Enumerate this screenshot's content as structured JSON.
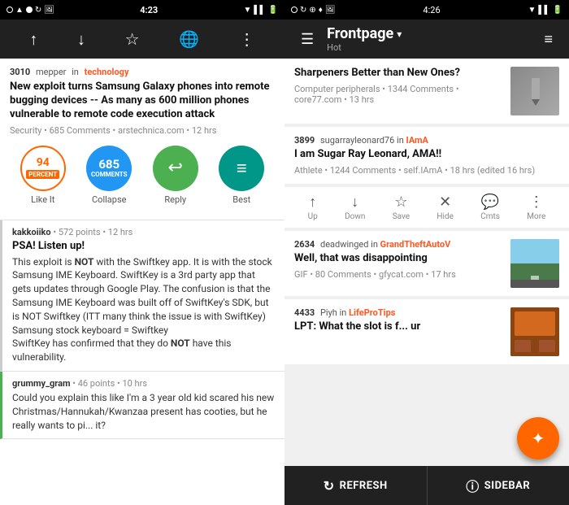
{
  "left": {
    "status_bar": {
      "time": "4:23",
      "icons": [
        "signal",
        "wifi",
        "battery"
      ]
    },
    "toolbar": {
      "icons": [
        "up-arrow",
        "down-arrow",
        "star",
        "globe",
        "more-vert"
      ]
    },
    "post": {
      "score": "3010",
      "username": "mepper",
      "in_text": "in",
      "subreddit": "technology",
      "title": "New exploit turns Samsung Galaxy phones into remote bugging devices -- As many as 600 million phones vulnerable to remote code execution attack",
      "category": "Security",
      "comments": "685 Comments",
      "domain": "arstechnica.com",
      "age": "12 hrs",
      "like_it_percent": "94",
      "like_it_label": "PERCENT",
      "like_it_btn": "Like It",
      "collapse_count": "685",
      "collapse_label": "COMMENTS",
      "collapse_btn": "Collapse",
      "reply_btn": "Reply",
      "best_btn": "Best"
    },
    "comment": {
      "username": "kakkoiiko",
      "points": "572 points",
      "age": "12 hrs",
      "title": "PSA! Listen up!",
      "body_parts": [
        "This exploit is ",
        "NOT",
        " with the Swiftkey app. It is with the stock Samsung IME Keyboard. SwiftKey is a 3rd party app that gets updates through Google Play. The confusion is that the Samsung IME Keyboard was built off of SwiftKey's SDK, but is NOT Swiftkey (ITT many think the issue is with SwiftKey)\nSamsung stock keyboard = Swiftkey\nSwiftKey has confirmed that they do ",
        "NOT",
        " have this vulnerability."
      ]
    },
    "reply": {
      "username": "grummy_gram",
      "points": "46 points",
      "age": "10 hrs",
      "text": "Could you explain this like I'm a 3 year old kid scared his new Christmas/Hannukah/Kwanzaa present has cooties, but he really wants to pi... it?"
    }
  },
  "right": {
    "status_bar": {
      "time": "4:26",
      "icons": [
        "signal",
        "wifi",
        "battery"
      ]
    },
    "toolbar": {
      "title": "Frontpage",
      "subtitle": "Hot",
      "dropdown": "▾"
    },
    "feed_item_partial": {
      "title": "Sharpeners Better than New Ones?",
      "subreddit": "Computer peripherals",
      "comments": "1344 Comments",
      "domain": "core77.com",
      "age": "13 hrs"
    },
    "feed_item_1": {
      "score": "3899",
      "username": "sugarrayleonard76",
      "in_text": "in",
      "subreddit": "IAmA",
      "title": "I am Sugar Ray Leonard, AMA!!",
      "category": "Athlete",
      "comments": "1244 Comments",
      "domain": "self.IAmA",
      "age": "18 hrs",
      "edited": "(edited 16 hrs)"
    },
    "actions": {
      "up": "Up",
      "down": "Down",
      "save": "Save",
      "hide": "Hide",
      "cmts": "Cmts",
      "more": "More"
    },
    "feed_item_2": {
      "score": "2634",
      "username": "deadwinged",
      "in_text": "in",
      "subreddit": "GrandTheftAutoV",
      "title": "Well, that was disappointing",
      "category": "GIF",
      "comments": "80 Comments",
      "domain": "gfycat.com",
      "age": "17 hrs"
    },
    "feed_item_3": {
      "score": "4433",
      "username": "Piyh",
      "in_text": "in",
      "subreddit": "LifeProTips",
      "title": "LPT: What the slot is f... ur",
      "category": "",
      "comments": "",
      "domain": "",
      "age": ""
    },
    "bottom_bar": {
      "refresh_label": "REFRESH",
      "sidebar_label": "SIDEBAR"
    }
  }
}
